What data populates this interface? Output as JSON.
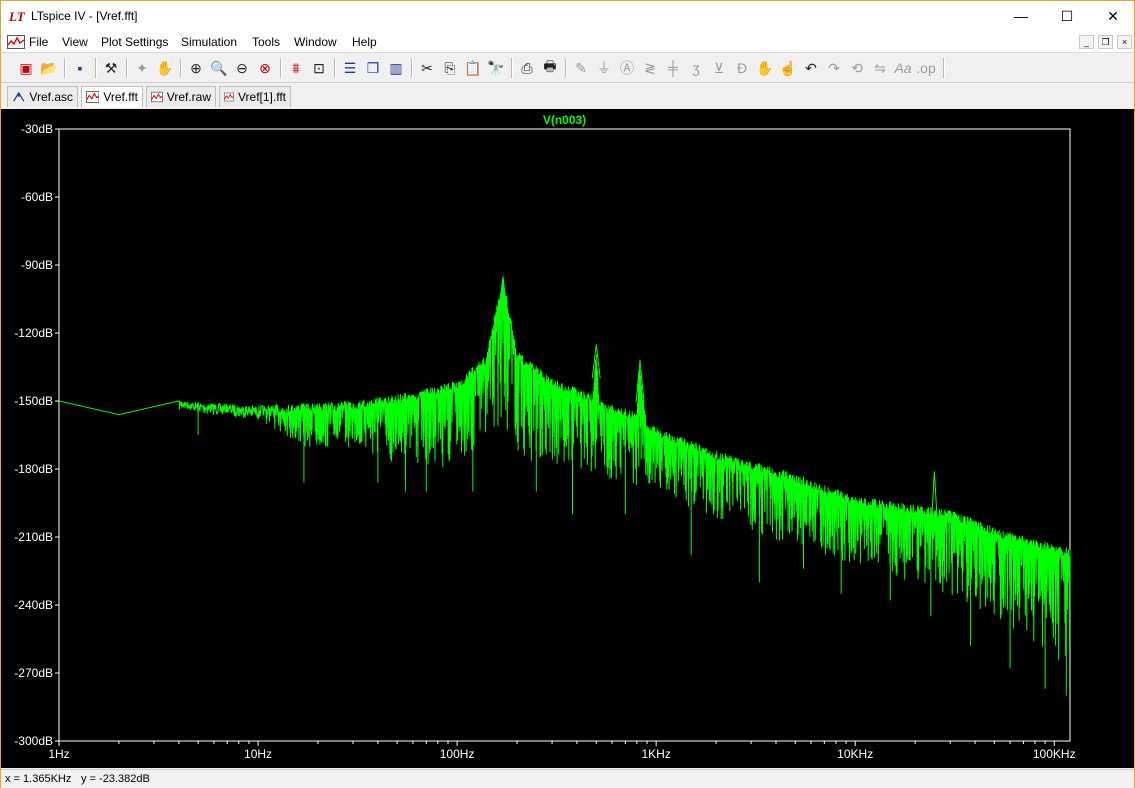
{
  "window": {
    "title": "LTspice IV - [Vref.fft]",
    "logo_text": "LT"
  },
  "title_buttons": {
    "minimize": "—",
    "maximize": "☐",
    "close": "✕"
  },
  "menu": [
    "File",
    "View",
    "Plot Settings",
    "Simulation",
    "Tools",
    "Window",
    "Help"
  ],
  "toolbar_icons": [
    "new-schematic-icon",
    "open-icon",
    "save-icon",
    "control-panel-icon",
    "run-icon",
    "halt-icon",
    "zoom-in-icon",
    "zoom-area-icon",
    "zoom-out-icon",
    "zoom-cancel-icon",
    "autorange-icon",
    "marker-icon",
    "tile-horizontal-icon",
    "cascade-icon",
    "tile-vertical-icon",
    "cut-icon",
    "copy-icon",
    "paste-icon",
    "find-icon",
    "print-setup-icon",
    "print-icon",
    "wire-icon",
    "ground-icon",
    "label-icon",
    "resistor-icon",
    "capacitor-icon",
    "inductor-icon",
    "diode-icon",
    "component-icon",
    "move-icon",
    "drag-icon",
    "undo-icon",
    "redo-icon",
    "rotate-icon",
    "mirror-icon",
    "text-icon",
    "spice-directive-icon"
  ],
  "tabs": [
    {
      "label": "Vref.asc",
      "active": false,
      "icon": "schematic-icon"
    },
    {
      "label": "Vref.fft",
      "active": true,
      "icon": "waveform-icon"
    },
    {
      "label": "Vref.raw",
      "active": false,
      "icon": "waveform-icon"
    },
    {
      "label": "Vref[1].fft",
      "active": false,
      "icon": "waveform-icon"
    }
  ],
  "chart_data": {
    "type": "line",
    "title": "V(n003)",
    "xscale": "log",
    "xlim": [
      1,
      120000
    ],
    "ylim": [
      -300,
      -30
    ],
    "x_ticks": [
      "1Hz",
      "10Hz",
      "100Hz",
      "1KHz",
      "10KHz",
      "100KHz"
    ],
    "x_tick_values": [
      1,
      10,
      100,
      1000,
      10000,
      100000
    ],
    "y_ticks": [
      "-30dB",
      "-60dB",
      "-90dB",
      "-120dB",
      "-150dB",
      "-180dB",
      "-210dB",
      "-240dB",
      "-270dB",
      "-300dB"
    ],
    "y_tick_values": [
      -30,
      -60,
      -90,
      -120,
      -150,
      -180,
      -210,
      -240,
      -270,
      -300
    ],
    "series": [
      {
        "name": "V(n003)",
        "color": "#00ff00",
        "envelope_upper": [
          [
            1,
            -150
          ],
          [
            2,
            -156
          ],
          [
            4,
            -150
          ],
          [
            10,
            -152
          ],
          [
            30,
            -150
          ],
          [
            60,
            -146
          ],
          [
            100,
            -141
          ],
          [
            140,
            -130
          ],
          [
            170,
            -95
          ],
          [
            200,
            -128
          ],
          [
            300,
            -140
          ],
          [
            480,
            -147
          ],
          [
            500,
            -125
          ],
          [
            520,
            -150
          ],
          [
            800,
            -155
          ],
          [
            820,
            -132
          ],
          [
            900,
            -160
          ],
          [
            2000,
            -172
          ],
          [
            5000,
            -182
          ],
          [
            10000,
            -192
          ],
          [
            30000,
            -198
          ],
          [
            60000,
            -208
          ],
          [
            120000,
            -215
          ]
        ],
        "envelope_lower": [
          [
            1,
            -150
          ],
          [
            2,
            -156
          ],
          [
            4,
            -152
          ],
          [
            5,
            -165
          ],
          [
            10,
            -165
          ],
          [
            17,
            -186
          ],
          [
            30,
            -180
          ],
          [
            40,
            -186
          ],
          [
            100,
            -184
          ],
          [
            170,
            -160
          ],
          [
            200,
            -176
          ],
          [
            500,
            -183
          ],
          [
            1000,
            -190
          ],
          [
            2000,
            -202
          ],
          [
            5000,
            -215
          ],
          [
            10000,
            -222
          ],
          [
            30000,
            -236
          ],
          [
            60000,
            -250
          ],
          [
            120000,
            -268
          ]
        ],
        "nulls": [
          [
            5,
            -165
          ],
          [
            17,
            -186
          ],
          [
            40,
            -186
          ],
          [
            55,
            -190
          ],
          [
            70,
            -190
          ],
          [
            120,
            -190
          ],
          [
            250,
            -190
          ],
          [
            380,
            -200
          ],
          [
            700,
            -200
          ],
          [
            1500,
            -218
          ],
          [
            3300,
            -230
          ],
          [
            5500,
            -224
          ],
          [
            8500,
            -235
          ],
          [
            15000,
            -238
          ],
          [
            24000,
            -245
          ],
          [
            38000,
            -258
          ],
          [
            60000,
            -268
          ],
          [
            90000,
            -277
          ],
          [
            115000,
            -280
          ]
        ],
        "spikes": [
          [
            170,
            -95
          ],
          [
            500,
            -125
          ],
          [
            830,
            -132
          ],
          [
            25000,
            -181
          ]
        ]
      }
    ],
    "grid": false,
    "background": "#000000",
    "axis_color": "#ffffff"
  },
  "status": {
    "x_readout": "x = 1.365KHz",
    "y_readout": "y = -23.382dB"
  },
  "colors": {
    "plot_bg": "#000000",
    "trace": "#00ff00",
    "title_text": "#00ff00",
    "axis": "#ffffff",
    "logo": "#b50000"
  }
}
